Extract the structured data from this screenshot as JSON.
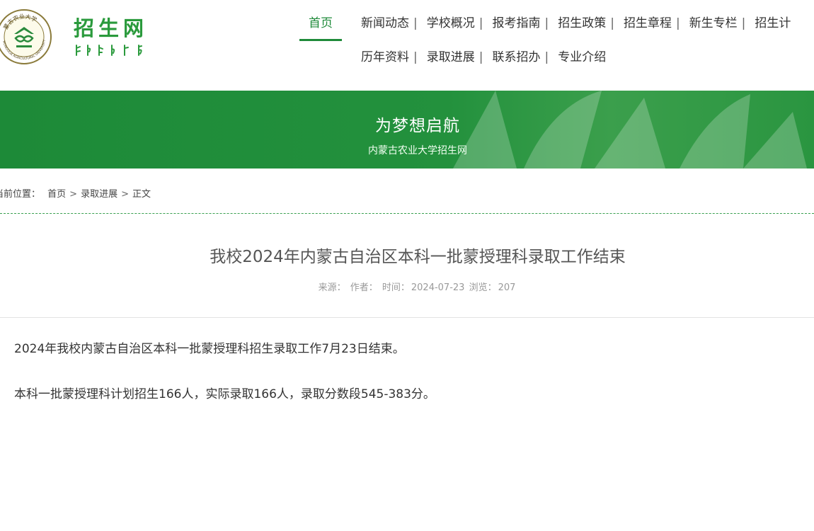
{
  "brand": {
    "seal_text_top": "蒙古农业大学",
    "seal_text_bottom": "MONGOLIA AGRICULTURAL UNIVERSITY",
    "site_name": "招生网"
  },
  "nav": {
    "row1": [
      {
        "label": "首页",
        "active": true
      },
      {
        "label": "新闻动态"
      },
      {
        "label": "学校概况"
      },
      {
        "label": "报考指南"
      },
      {
        "label": "招生政策"
      },
      {
        "label": "招生章程"
      },
      {
        "label": "新生专栏"
      },
      {
        "label": "招生计"
      }
    ],
    "row2": [
      {
        "label": "历年资料"
      },
      {
        "label": "录取进展"
      },
      {
        "label": "联系招办"
      },
      {
        "label": "专业介绍"
      }
    ],
    "separator": "|"
  },
  "banner": {
    "title": "为梦想启航",
    "subtitle": "内蒙古农业大学招生网"
  },
  "breadcrumb": {
    "prefix": "当前位置：",
    "items": [
      "首页",
      "录取进展",
      "正文"
    ],
    "separator": ">"
  },
  "article": {
    "title": "我校2024年内蒙古自治区本科一批蒙授理科录取工作结束",
    "meta": {
      "source_label": "来源：",
      "author_label": "作者：",
      "time_label": "时间：",
      "time_value": "2024-07-23",
      "views_label": "浏览：",
      "views_value": "207"
    },
    "paragraphs": [
      "2024年我校内蒙古自治区本科一批蒙授理科招生录取工作7月23日结束。",
      "本科一批蒙授理科计划招生166人，实际录取166人，录取分数段545-383分。"
    ]
  },
  "colors": {
    "brand_green": "#1f8a3a",
    "banner_green": "#23913d",
    "logo_green": "#2a9a3c"
  }
}
